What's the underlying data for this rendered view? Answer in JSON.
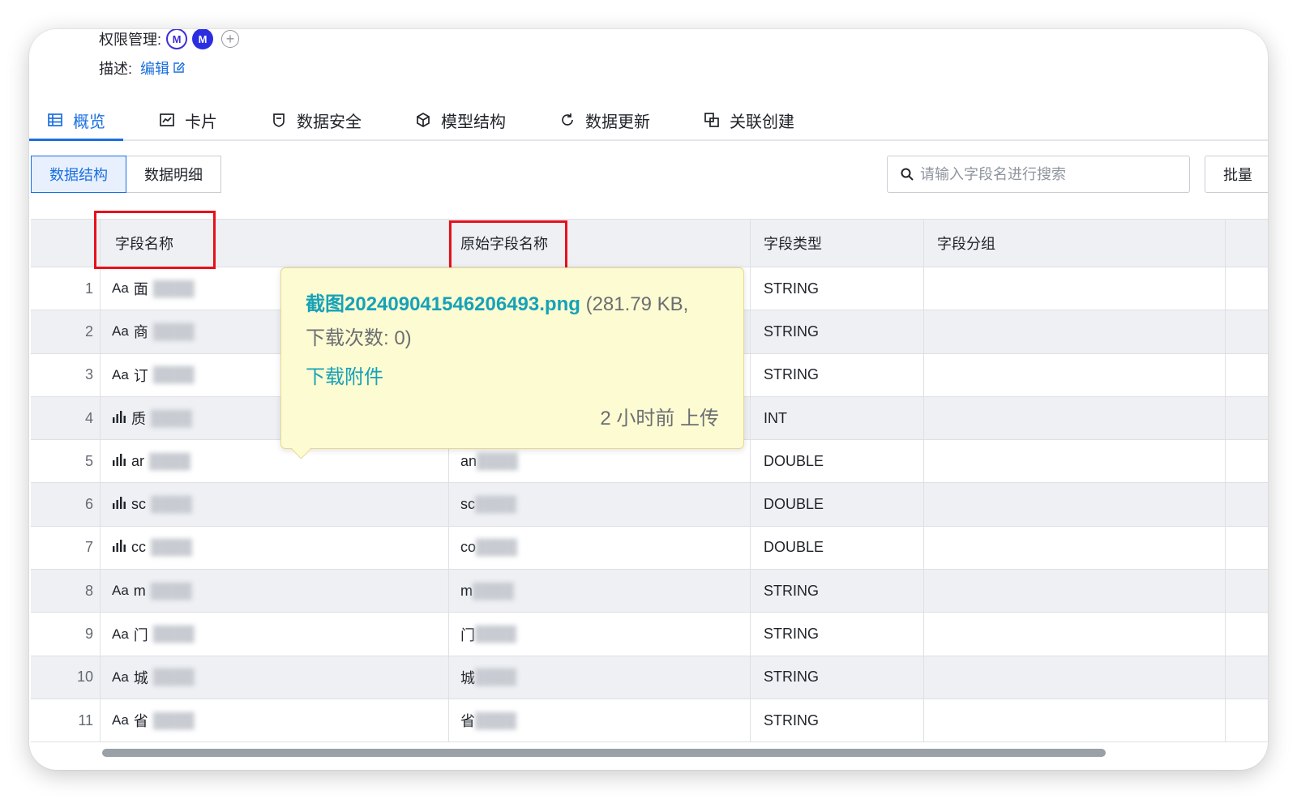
{
  "meta": {
    "permission_label": "权限管理:",
    "description_label": "描述:",
    "edit_label": "编辑"
  },
  "tabs": [
    {
      "label": "概览",
      "icon": "table-icon",
      "active": true
    },
    {
      "label": "卡片",
      "icon": "chart-card-icon",
      "active": false
    },
    {
      "label": "数据安全",
      "icon": "shield-icon",
      "active": false
    },
    {
      "label": "模型结构",
      "icon": "cube-icon",
      "active": false
    },
    {
      "label": "数据更新",
      "icon": "refresh-icon",
      "active": false
    },
    {
      "label": "关联创建",
      "icon": "link-create-icon",
      "active": false
    }
  ],
  "segment": {
    "structure_label": "数据结构",
    "detail_label": "数据明细"
  },
  "search": {
    "placeholder": "请输入字段名进行搜索"
  },
  "batch_label": "批量",
  "table": {
    "headers": [
      "字段名称",
      "原始字段名称",
      "字段类型",
      "字段分组"
    ],
    "rows": [
      {
        "idx": "1",
        "kind": "Aa",
        "name": "面",
        "raw": "",
        "type": "STRING"
      },
      {
        "idx": "2",
        "kind": "Aa",
        "name": "商",
        "raw": "",
        "type": "STRING"
      },
      {
        "idx": "3",
        "kind": "Aa",
        "name": "订",
        "raw": "",
        "type": "STRING"
      },
      {
        "idx": "4",
        "kind": "bar",
        "name": "质",
        "raw": "",
        "type": "INT"
      },
      {
        "idx": "5",
        "kind": "bar",
        "name": "ar",
        "raw": "an",
        "type": "DOUBLE"
      },
      {
        "idx": "6",
        "kind": "bar",
        "name": "sc",
        "raw": "sc",
        "type": "DOUBLE"
      },
      {
        "idx": "7",
        "kind": "bar",
        "name": "cc",
        "raw": "co",
        "type": "DOUBLE"
      },
      {
        "idx": "8",
        "kind": "Aa",
        "name": "m",
        "raw": "m",
        "type": "STRING"
      },
      {
        "idx": "9",
        "kind": "Aa",
        "name": "门",
        "raw": "门",
        "type": "STRING"
      },
      {
        "idx": "10",
        "kind": "Aa",
        "name": "城",
        "raw": "城",
        "type": "STRING"
      },
      {
        "idx": "11",
        "kind": "Aa",
        "name": "省",
        "raw": "省",
        "type": "STRING"
      }
    ]
  },
  "tooltip": {
    "file_name": "截图20240904154620649​3.png",
    "file_meta": "(281.79 KB,",
    "download_count": "下载次数: 0)",
    "download_label": "下载附件",
    "upload_time": "2 小时前 上传"
  },
  "colors": {
    "accent": "#1a6fe0",
    "highlight": "#e8101b",
    "tooltip_bg": "#fdfbd2",
    "link_teal": "#16a2b8"
  }
}
